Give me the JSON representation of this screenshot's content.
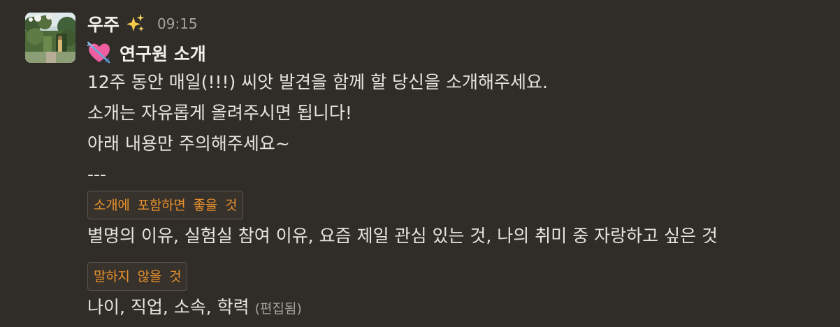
{
  "message": {
    "sender": "우주",
    "status_emoji": "sparkles-icon",
    "timestamp": "09:15",
    "title_icon": "heart-with-arrow-icon",
    "title": "연구원 소개",
    "lines": [
      "12주 동안 매일(!!!) 씨앗 발견을 함께 할 당신을 소개해주세요.",
      "소개는 자유롭게 올려주시면 됩니다!",
      "아래 내용만 주의해주세요~",
      "---"
    ],
    "sections": [
      {
        "label": "소개에 포함하면 좋을 것",
        "content": "별명의 이유, 실험실 참여 이유, 요즘 제일 관심 있는 것, 나의 취미 중 자랑하고 싶은 것"
      },
      {
        "label": "말하지 않을 것",
        "content": "나이, 직업, 소속, 학력"
      }
    ],
    "edited_label": "(편집됨)"
  },
  "colors": {
    "background": "#302d29",
    "text": "#e6e4e0",
    "code_text": "#e8912d",
    "muted": "#a6a39d"
  }
}
